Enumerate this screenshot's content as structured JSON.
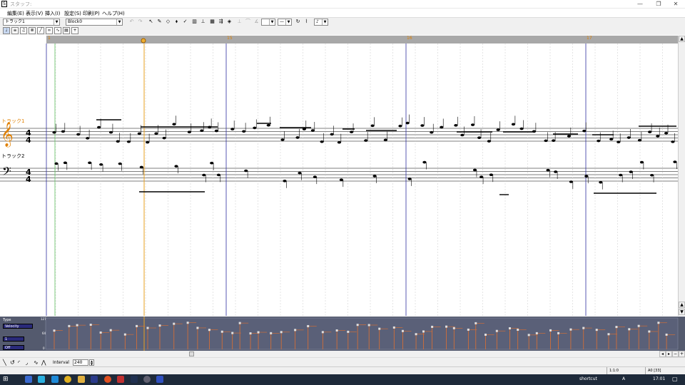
{
  "window": {
    "title": "スタッフ:",
    "app_icon_label": "S"
  },
  "menu": [
    {
      "label": "編集(E)"
    },
    {
      "label": "表示(V)"
    },
    {
      "label": "挿入(I)"
    },
    {
      "label": "設定(S)"
    },
    {
      "label": "印刷(P)"
    },
    {
      "label": "ヘルプ(H)"
    }
  ],
  "toolbar": {
    "track_select": "トラック1",
    "block_select": "Block0",
    "rest_select": "—",
    "note_select": "♪"
  },
  "ruler": {
    "bars": [
      "1",
      "15",
      "16",
      "17"
    ]
  },
  "score": {
    "track1_label": "トラック1",
    "track2_label": "トラック2",
    "time_signature_top": "4",
    "time_signature_bottom": "4"
  },
  "velocity_panel": {
    "type_label": "Type",
    "type_value": "Velocity",
    "channel_value": "1",
    "mode_value": "Off",
    "scale_top": "127",
    "scale_mid": "64",
    "scale_bottom": "0"
  },
  "bottom": {
    "interval_label": "Interval",
    "interval_value": "240"
  },
  "status": {
    "position": "1:1:0",
    "note": "A0 [33]"
  },
  "taskbar": {
    "shortcut_label": "shortcut",
    "time": "17:01",
    "ime_label": "A"
  },
  "colors": {
    "ruler": "#a8a8a8",
    "velocity_bg": "#545a6e",
    "playhead": "#e8a020",
    "barline": "#3030a0"
  }
}
